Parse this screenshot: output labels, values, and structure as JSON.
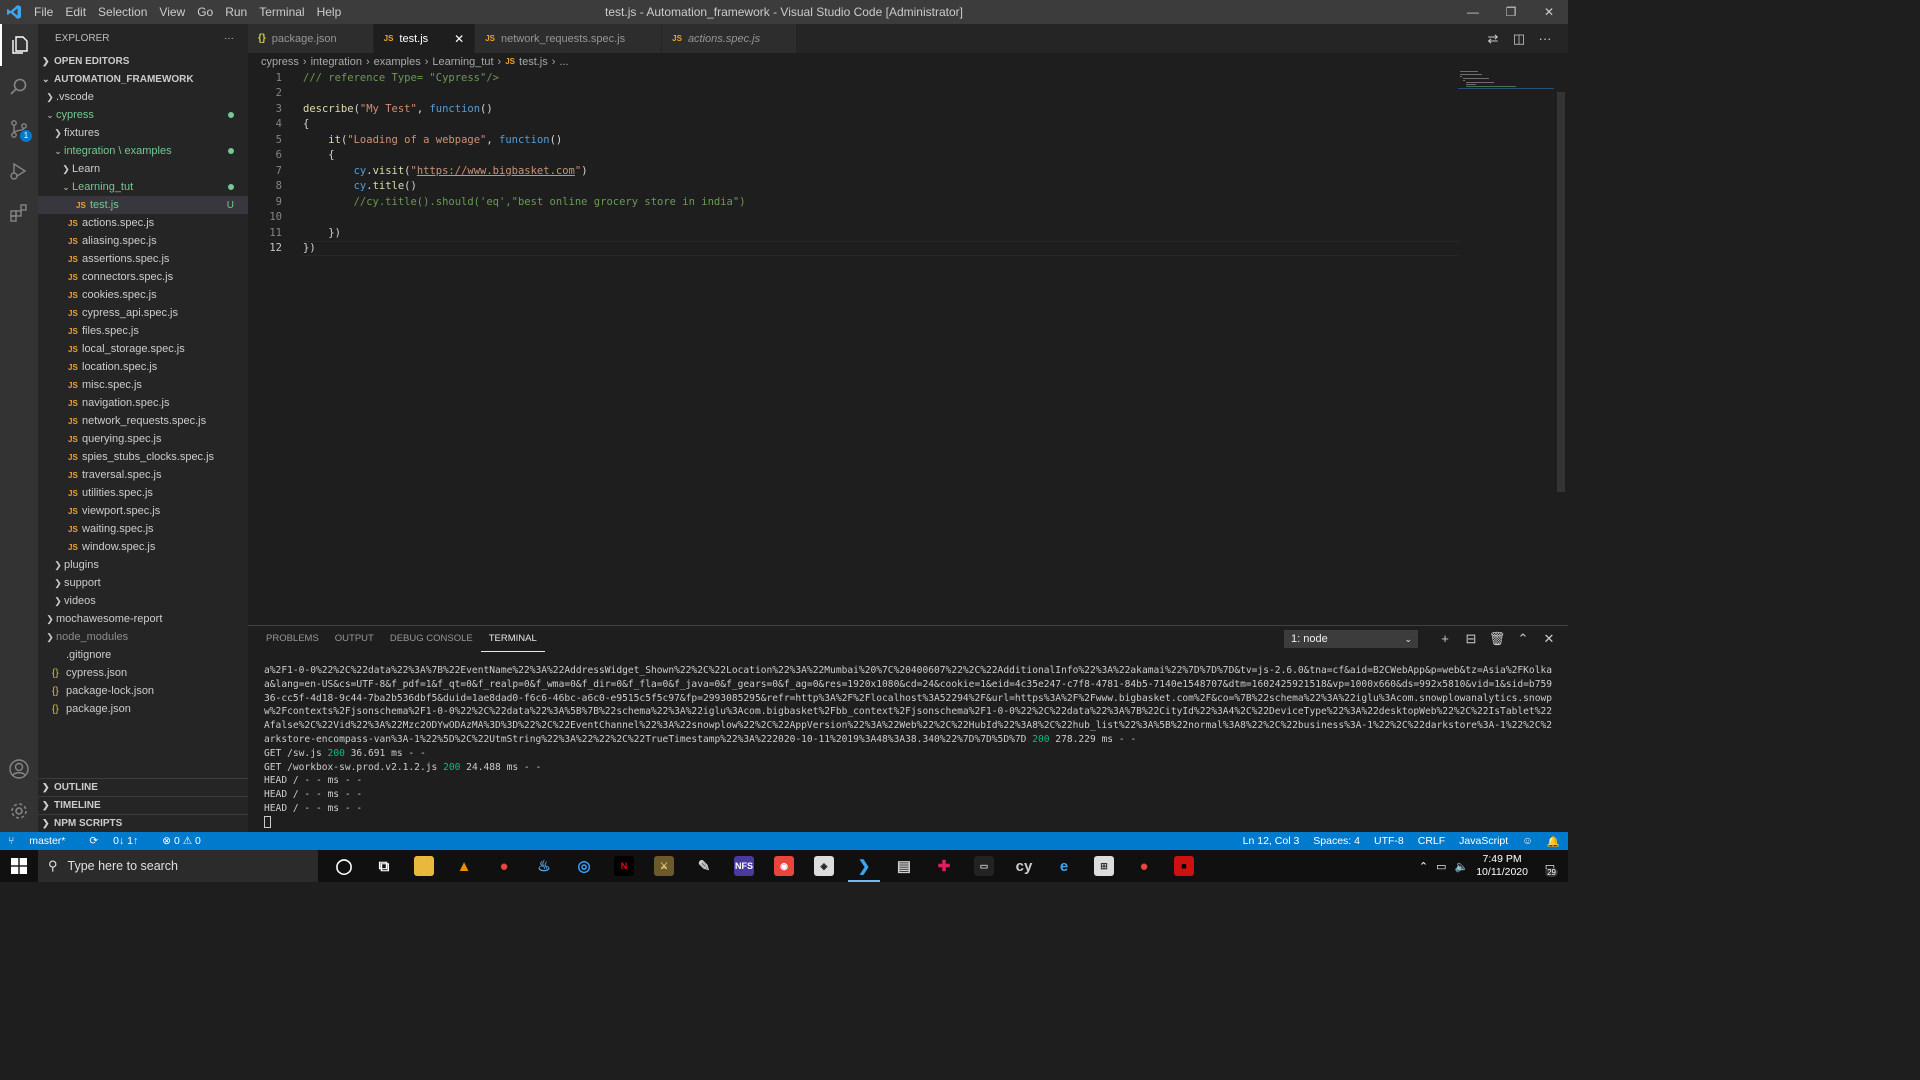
{
  "window": {
    "title": "test.js - Automation_framework - Visual Studio Code [Administrator]",
    "menu": [
      "File",
      "Edit",
      "Selection",
      "View",
      "Go",
      "Run",
      "Terminal",
      "Help"
    ],
    "controls": [
      "—",
      "❐",
      "✕"
    ]
  },
  "activity_bar": {
    "items": [
      "explorer-icon",
      "search-icon",
      "source-control-icon",
      "run-debug-icon",
      "extensions-icon"
    ],
    "scm_badge": "1",
    "bottom": [
      "account-icon",
      "settings-gear-icon"
    ]
  },
  "sidebar": {
    "title": "EXPLORER",
    "more": "···",
    "open_editors": "OPEN EDITORS",
    "project": "AUTOMATION_FRAMEWORK",
    "tree": [
      {
        "label": ".vscode",
        "type": "folder",
        "open": false,
        "indent": 1
      },
      {
        "label": "cypress",
        "type": "folder",
        "open": true,
        "indent": 1,
        "status": "green",
        "dot": true
      },
      {
        "label": "fixtures",
        "type": "folder",
        "open": false,
        "indent": 2
      },
      {
        "label": "integration \\ examples",
        "type": "folder",
        "open": true,
        "indent": 2,
        "status": "green",
        "dot": true
      },
      {
        "label": "Learn",
        "type": "folder",
        "open": false,
        "indent": 3
      },
      {
        "label": "Learning_tut",
        "type": "folder",
        "open": true,
        "indent": 3,
        "status": "green",
        "dot": true
      },
      {
        "label": "test.js",
        "type": "js",
        "indent": 4,
        "status": "green",
        "badge": "U",
        "selected": true
      },
      {
        "label": "actions.spec.js",
        "type": "js",
        "indent": 3
      },
      {
        "label": "aliasing.spec.js",
        "type": "js",
        "indent": 3
      },
      {
        "label": "assertions.spec.js",
        "type": "js",
        "indent": 3
      },
      {
        "label": "connectors.spec.js",
        "type": "js",
        "indent": 3
      },
      {
        "label": "cookies.spec.js",
        "type": "js",
        "indent": 3
      },
      {
        "label": "cypress_api.spec.js",
        "type": "js",
        "indent": 3
      },
      {
        "label": "files.spec.js",
        "type": "js",
        "indent": 3
      },
      {
        "label": "local_storage.spec.js",
        "type": "js",
        "indent": 3
      },
      {
        "label": "location.spec.js",
        "type": "js",
        "indent": 3
      },
      {
        "label": "misc.spec.js",
        "type": "js",
        "indent": 3
      },
      {
        "label": "navigation.spec.js",
        "type": "js",
        "indent": 3
      },
      {
        "label": "network_requests.spec.js",
        "type": "js",
        "indent": 3
      },
      {
        "label": "querying.spec.js",
        "type": "js",
        "indent": 3
      },
      {
        "label": "spies_stubs_clocks.spec.js",
        "type": "js",
        "indent": 3
      },
      {
        "label": "traversal.spec.js",
        "type": "js",
        "indent": 3
      },
      {
        "label": "utilities.spec.js",
        "type": "js",
        "indent": 3
      },
      {
        "label": "viewport.spec.js",
        "type": "js",
        "indent": 3
      },
      {
        "label": "waiting.spec.js",
        "type": "js",
        "indent": 3
      },
      {
        "label": "window.spec.js",
        "type": "js",
        "indent": 3
      },
      {
        "label": "plugins",
        "type": "folder",
        "open": false,
        "indent": 2
      },
      {
        "label": "support",
        "type": "folder",
        "open": false,
        "indent": 2
      },
      {
        "label": "videos",
        "type": "folder",
        "open": false,
        "indent": 2
      },
      {
        "label": "mochawesome-report",
        "type": "folder",
        "open": false,
        "indent": 1
      },
      {
        "label": "node_modules",
        "type": "folder",
        "open": false,
        "indent": 1,
        "status": "dim"
      },
      {
        "label": ".gitignore",
        "type": "file",
        "indent": 1
      },
      {
        "label": "cypress.json",
        "type": "json",
        "indent": 1
      },
      {
        "label": "package-lock.json",
        "type": "json",
        "indent": 1
      },
      {
        "label": "package.json",
        "type": "json",
        "indent": 1
      }
    ],
    "bottom_sections": [
      "OUTLINE",
      "TIMELINE",
      "NPM SCRIPTS"
    ]
  },
  "tabs": [
    {
      "label": "package.json",
      "icon": "json",
      "active": false,
      "italic": false
    },
    {
      "label": "test.js",
      "icon": "js",
      "active": true,
      "italic": false
    },
    {
      "label": "network_requests.spec.js",
      "icon": "js",
      "active": false,
      "italic": false
    },
    {
      "label": "actions.spec.js",
      "icon": "js",
      "active": false,
      "italic": true
    }
  ],
  "breadcrumb": [
    "cypress",
    "integration",
    "examples",
    "Learning_tut",
    "test.js",
    "..."
  ],
  "editor": {
    "lines": [
      [
        {
          "t": "/// reference Type= \"Cypress\"/>",
          "c": "cm"
        }
      ],
      [],
      [
        {
          "t": "describe",
          "c": "fn"
        },
        {
          "t": "(",
          "c": ""
        },
        {
          "t": "\"My Test\"",
          "c": "str"
        },
        {
          "t": ", ",
          "c": ""
        },
        {
          "t": "function",
          "c": "kw"
        },
        {
          "t": "()",
          "c": ""
        }
      ],
      [
        {
          "t": "{",
          "c": ""
        }
      ],
      [
        {
          "t": "    ",
          "c": ""
        },
        {
          "t": "it",
          "c": "fn"
        },
        {
          "t": "(",
          "c": ""
        },
        {
          "t": "\"Loading of a webpage\"",
          "c": "str"
        },
        {
          "t": ", ",
          "c": ""
        },
        {
          "t": "function",
          "c": "kw"
        },
        {
          "t": "()",
          "c": ""
        }
      ],
      [
        {
          "t": "    {",
          "c": ""
        }
      ],
      [
        {
          "t": "        ",
          "c": ""
        },
        {
          "t": "cy",
          "c": "kw"
        },
        {
          "t": ".",
          "c": ""
        },
        {
          "t": "visit",
          "c": "fn"
        },
        {
          "t": "(",
          "c": ""
        },
        {
          "t": "\"",
          "c": "str"
        },
        {
          "t": "https://www.bigbasket.com",
          "c": "link"
        },
        {
          "t": "\"",
          "c": "str"
        },
        {
          "t": ")",
          "c": ""
        }
      ],
      [
        {
          "t": "        ",
          "c": ""
        },
        {
          "t": "cy",
          "c": "kw"
        },
        {
          "t": ".",
          "c": ""
        },
        {
          "t": "title",
          "c": "fn"
        },
        {
          "t": "()",
          "c": ""
        }
      ],
      [
        {
          "t": "        ",
          "c": ""
        },
        {
          "t": "//cy.title().should('eq',\"best online grocery store in india\")",
          "c": "cm"
        }
      ],
      [],
      [
        {
          "t": "    })",
          "c": ""
        }
      ],
      [
        {
          "t": "})",
          "c": ""
        }
      ]
    ],
    "current_line": 12
  },
  "panel": {
    "tabs": [
      "PROBLEMS",
      "OUTPUT",
      "DEBUG CONSOLE",
      "TERMINAL"
    ],
    "active_tab": "TERMINAL",
    "terminal_select": "1: node",
    "actions": [
      "+",
      "⊟",
      "🗑",
      "⌃",
      "✕"
    ],
    "terminal_lines": [
      [
        {
          "t": "a%2F1-0-0%22%2C%22data%22%3A%7B%22EventName%22%3A%22AddressWidget_Shown%22%2C%22Location%22%3A%22Mumbai%20%7C%20400607%22%2C%22AdditionalInfo%22%3A%22akamai%22%7D%7D%7D&tv=js-2.6.0&tna=cf&aid=B2CWebApp&p=web&tz=Asia%2FKolkat",
          "c": ""
        }
      ],
      [
        {
          "t": "a&lang=en-US&cs=UTF-8&f_pdf=1&f_qt=0&f_realp=0&f_wma=0&f_dir=0&f_fla=0&f_java=0&f_gears=0&f_ag=0&res=1920x1080&cd=24&cookie=1&eid=4c35e247-c7f8-4781-84b5-7140e1548707&dtm=1602425921518&vp=1000x660&ds=992x5810&vid=1&sid=b759f6",
          "c": ""
        }
      ],
      [
        {
          "t": "36-cc5f-4d18-9c44-7ba2b536dbf5&duid=1ae8dad0-f6c6-46bc-a6c0-e9515c5f5c97&fp=2993085295&refr=http%3A%2F%2Flocalhost%3A52294%2F&url=https%3A%2F%2Fwww.bigbasket.com%2F&co=%7B%22schema%22%3A%22iglu%3Acom.snowplowanalytics.snowplo",
          "c": ""
        }
      ],
      [
        {
          "t": "w%2Fcontexts%2Fjsonschema%2F1-0-0%22%2C%22data%22%3A%5B%7B%22schema%22%3A%22iglu%3Acom.bigbasket%2Fbb_context%2Fjsonschema%2F1-0-0%22%2C%22data%22%3A%7B%22CityId%22%3A4%2C%22DeviceType%22%3A%22desktopWeb%22%2C%22IsTablet%22%3",
          "c": ""
        }
      ],
      [
        {
          "t": "Afalse%2C%22Vid%22%3A%22Mzc2ODYwODAzMA%3D%3D%22%2C%22EventChannel%22%3A%22snowplow%22%2C%22AppVersion%22%3A%22Web%22%2C%22HubId%22%3A8%2C%22hub_list%22%3A%5B%22normal%3A8%22%2C%22business%3A-1%22%2C%22darkstore%3A-1%22%2C%22d",
          "c": ""
        }
      ],
      [
        {
          "t": "arkstore-encompass-van%3A-1%22%5D%2C%22UtmString%22%3A%22%22%2C%22TrueTimestamp%22%3A%222020-10-11%2019%3A48%3A38.340%22%7D%7D%5D%7D ",
          "c": ""
        },
        {
          "t": "200",
          "c": "ok"
        },
        {
          "t": " 278.229 ms - -",
          "c": ""
        }
      ],
      [
        {
          "t": "GET /sw.js ",
          "c": ""
        },
        {
          "t": "200",
          "c": "ok"
        },
        {
          "t": " 36.691 ms - -",
          "c": ""
        }
      ],
      [
        {
          "t": "GET /workbox-sw.prod.v2.1.2.js ",
          "c": ""
        },
        {
          "t": "200",
          "c": "ok"
        },
        {
          "t": " 24.488 ms - -",
          "c": ""
        }
      ],
      [
        {
          "t": "HEAD / - - ms - -",
          "c": ""
        }
      ],
      [
        {
          "t": "HEAD / - - ms - -",
          "c": ""
        }
      ],
      [
        {
          "t": "HEAD / - - ms - -",
          "c": ""
        }
      ]
    ]
  },
  "statusbar": {
    "branch": "master*",
    "sync": "0↓ 1↑",
    "problems": "⊗ 0 ⚠ 0",
    "position": "Ln 12, Col 3",
    "spaces": "Spaces: 4",
    "encoding": "UTF-8",
    "eol": "CRLF",
    "language": "JavaScript"
  },
  "taskbar": {
    "search_placeholder": "Type here to search",
    "apps": [
      {
        "name": "cortana-icon",
        "glyph": "◯",
        "bg": "",
        "fg": "#ffffff"
      },
      {
        "name": "task-view-icon",
        "glyph": "⧉",
        "bg": "",
        "fg": "#ffffff"
      },
      {
        "name": "file-explorer-icon",
        "glyph": "▬",
        "bg": "#e8b93c",
        "fg": "#e8b93c"
      },
      {
        "name": "vlc-icon",
        "glyph": "▲",
        "bg": "",
        "fg": "#f08c00"
      },
      {
        "name": "chrome-icon",
        "glyph": "●",
        "bg": "",
        "fg": "#e8453c"
      },
      {
        "name": "steam-icon",
        "glyph": "♨",
        "bg": "",
        "fg": "#5aa0d8"
      },
      {
        "name": "uplay-icon",
        "glyph": "◎",
        "bg": "",
        "fg": "#3aa0ff"
      },
      {
        "name": "netflix-icon",
        "glyph": "N",
        "bg": "#000000",
        "fg": "#e50914"
      },
      {
        "name": "game-icon",
        "glyph": "⚔",
        "bg": "#6b5a2a",
        "fg": "#f0d080"
      },
      {
        "name": "tool-icon",
        "glyph": "✎",
        "bg": "",
        "fg": "#cccccc"
      },
      {
        "name": "nfs-icon",
        "glyph": "NFS",
        "bg": "#4a3aa0",
        "fg": "#ffffff"
      },
      {
        "name": "origin-icon",
        "glyph": "◉",
        "bg": "#e8453c",
        "fg": "#ffffff"
      },
      {
        "name": "unity-icon",
        "glyph": "◈",
        "bg": "#dddddd",
        "fg": "#222222"
      },
      {
        "name": "vscode-taskbar-icon",
        "glyph": "❯",
        "bg": "",
        "fg": "#3ea6f0"
      },
      {
        "name": "app-icon",
        "glyph": "▤",
        "bg": "",
        "fg": "#cccccc"
      },
      {
        "name": "slack-icon",
        "glyph": "✚",
        "bg": "",
        "fg": "#e01e5a"
      },
      {
        "name": "terminal-icon",
        "glyph": "▭",
        "bg": "#222222",
        "fg": "#cccccc"
      },
      {
        "name": "cypress-icon",
        "glyph": "cy",
        "bg": "",
        "fg": "#cccccc"
      },
      {
        "name": "edge-icon",
        "glyph": "e",
        "bg": "",
        "fg": "#3ea6f0"
      },
      {
        "name": "store-icon",
        "glyph": "⊞",
        "bg": "#dddddd",
        "fg": "#333333"
      },
      {
        "name": "chrome2-icon",
        "glyph": "●",
        "bg": "",
        "fg": "#e8453c"
      },
      {
        "name": "red-app-icon",
        "glyph": "■",
        "bg": "#cc1111",
        "fg": "#000000"
      }
    ],
    "active_app": "vscode-taskbar-icon",
    "time": "7:49 PM",
    "date": "10/11/2020",
    "notifications": "29"
  }
}
